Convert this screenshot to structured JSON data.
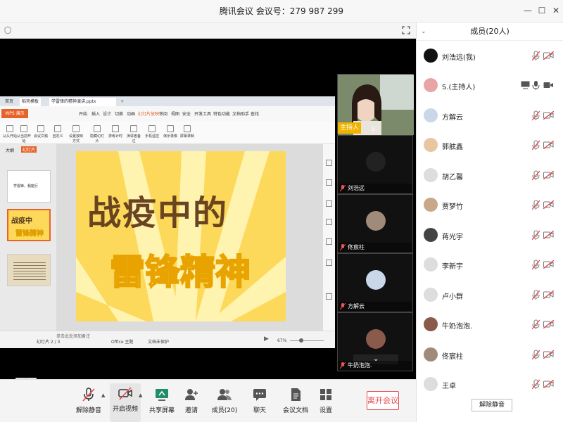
{
  "window": {
    "title": "腾讯会议  会议号：279 987 299"
  },
  "toolbar": {
    "mute": "解除静音",
    "video": "开启视频",
    "share": "共享屏幕",
    "invite": "邀请",
    "members": "成员(20)",
    "chat": "聊天",
    "docs": "会议文档",
    "settings": "设置",
    "leave": "离开会议"
  },
  "panel": {
    "title": "成员(20人)",
    "unmute_all": "解除静音",
    "members": [
      {
        "name": "刘浩远(我)",
        "avatar_color": "#111111"
      },
      {
        "name": "S.(主持人)",
        "avatar_color": "#e8a5a5"
      },
      {
        "name": "方解云",
        "avatar_color": "#c9d7e8"
      },
      {
        "name": "郭舷鑫",
        "avatar_color": "#e8c7a0"
      },
      {
        "name": "胡乙馨",
        "avatar_color": "#dddddd"
      },
      {
        "name": "贾梦竹",
        "avatar_color": "#c9a88a"
      },
      {
        "name": "蒋光宇",
        "avatar_color": "#444444"
      },
      {
        "name": "李新宇",
        "avatar_color": "#dddddd"
      },
      {
        "name": "卢小群",
        "avatar_color": "#dddddd"
      },
      {
        "name": "牛奶泡泡.",
        "avatar_color": "#8a5a4a"
      },
      {
        "name": "佟宸柱",
        "avatar_color": "#a08a7a"
      },
      {
        "name": "王卓",
        "avatar_color": "#dddddd"
      }
    ]
  },
  "videos": [
    {
      "name": "S.",
      "tag": "主持人"
    },
    {
      "name": "刘浩远"
    },
    {
      "name": "佟宸柱"
    },
    {
      "name": "方解云"
    },
    {
      "name": "牛奶泡泡."
    }
  ],
  "ppt": {
    "tabs": [
      "首页",
      "稻壳模板",
      "学雷锋的精神演讲.pptx"
    ],
    "wps": "WPS 演示",
    "menus": [
      "开始",
      "插入",
      "设计",
      "切换",
      "动画",
      "幻灯片放映",
      "审阅",
      "视图",
      "安全",
      "开发工具",
      "特色功能",
      "文档助手",
      "查找"
    ],
    "ribbon": [
      "从头开始",
      "从当前开始",
      "会议文稿",
      "自定义",
      "设置放映方式",
      "隐藏幻灯片",
      "排练计时",
      "演讲者备注",
      "手机遥控",
      "演示录像",
      "屏幕录制"
    ],
    "side_tabs": [
      "大纲",
      "幻灯片"
    ],
    "thumb1": "学雷锋，我能行",
    "slide_title_1": "战疫中的",
    "slide_title_2": "雷锋精神",
    "notes": "单击此处添加备注",
    "status_page": "幻灯片 2 / 3",
    "status_theme": "Office 主题",
    "status_protect": "文档未保护",
    "zoom": "67%"
  }
}
